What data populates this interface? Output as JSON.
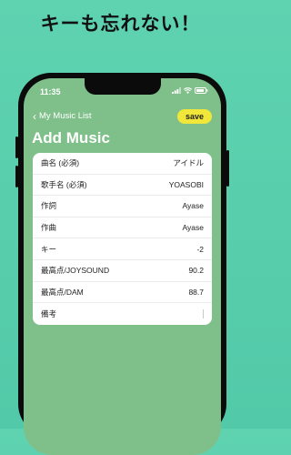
{
  "headline": "キーも忘れない！",
  "status": {
    "time": "11:35"
  },
  "nav": {
    "back_label": "My Music List",
    "save_label": "save"
  },
  "page_title": "Add Music",
  "form": {
    "rows": [
      {
        "label": "曲名 (必須)",
        "value": "アイドル"
      },
      {
        "label": "歌手名 (必須)",
        "value": "YOASOBI"
      },
      {
        "label": "作詞",
        "value": "Ayase"
      },
      {
        "label": "作曲",
        "value": "Ayase"
      },
      {
        "label": "キー",
        "value": "-2"
      },
      {
        "label": "最高点/JOYSOUND",
        "value": "90.2"
      },
      {
        "label": "最高点/DAM",
        "value": "88.7"
      },
      {
        "label": "備考",
        "value": ""
      }
    ]
  },
  "colors": {
    "screen_bg": "#7fc08a",
    "save_button": "#f1e63a",
    "background": "#5fd3b0"
  }
}
